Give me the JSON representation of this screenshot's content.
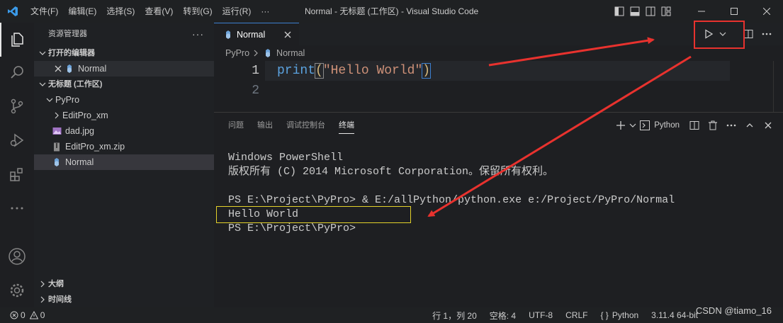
{
  "titlebar": {
    "menu": [
      "文件(F)",
      "编辑(E)",
      "选择(S)",
      "查看(V)",
      "转到(G)",
      "运行(R)",
      "···"
    ],
    "title": "Normal - 无标题 (工作区) - Visual Studio Code"
  },
  "sidebar": {
    "header": "资源管理器",
    "more": "···",
    "open_editors_label": "打开的编辑器",
    "open_editors": [
      {
        "label": "Normal"
      }
    ],
    "workspace_label": "无标题 (工作区)",
    "folder": "PyPro",
    "items": [
      {
        "label": "EditPro_xm"
      },
      {
        "label": "dad.jpg"
      },
      {
        "label": "EditPro_xm.zip"
      },
      {
        "label": "Normal"
      }
    ],
    "outline_label": "大纲",
    "timeline_label": "时间线"
  },
  "editor": {
    "tab_label": "Normal",
    "breadcrumb": [
      "PyPro",
      "Normal"
    ],
    "lines": [
      {
        "number": "1",
        "fn": "print",
        "open": "(",
        "string": "\"Hello World\"",
        "close": ")"
      },
      {
        "number": "2"
      }
    ]
  },
  "panel": {
    "tabs": [
      "问题",
      "输出",
      "调试控制台",
      "终端"
    ],
    "active_tab": "终端",
    "terminal_name": "Python",
    "terminal_lines": [
      "Windows PowerShell",
      "版权所有 (C) 2014 Microsoft Corporation。保留所有权利。",
      "",
      "PS E:\\Project\\PyPro> & E:/allPython/python.exe e:/Project/PyPro/Normal",
      "Hello World",
      "PS E:\\Project\\PyPro>"
    ]
  },
  "statusbar": {
    "errors": "0",
    "warnings": "0",
    "position": "行 1，列 20",
    "spaces": "空格: 4",
    "encoding": "UTF-8",
    "eol": "CRLF",
    "language": "Python",
    "interpreter": "3.11.4 64-bit"
  },
  "watermark": "CSDN @tiamo_16",
  "colors": {
    "accent_blue": "#3c7fcf",
    "annotation_red": "#e8322e",
    "annotation_yellow": "#e3d12a"
  }
}
